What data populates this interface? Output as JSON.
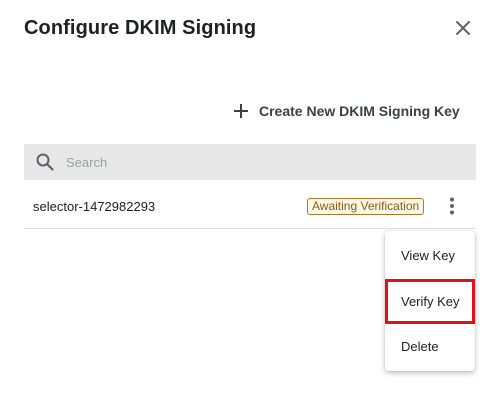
{
  "dialog": {
    "title": "Configure DKIM Signing",
    "close_icon": "close-icon"
  },
  "actions": {
    "create_label": "Create New DKIM Signing Key",
    "create_icon": "plus-icon"
  },
  "search": {
    "placeholder": "Search",
    "value": "",
    "icon": "search-icon"
  },
  "keys": [
    {
      "selector": "selector-1472982293",
      "status": "Awaiting Verification",
      "menu_icon": "more-vertical-icon"
    }
  ],
  "context_menu": {
    "items": [
      {
        "label": "View Key"
      },
      {
        "label": "Verify Key",
        "highlighted": true
      },
      {
        "label": "Delete"
      }
    ]
  },
  "colors": {
    "highlight": "#e0111b",
    "badge_border": "#b3772a",
    "badge_text": "#8a5a12",
    "search_bg": "#e8e8e8"
  }
}
